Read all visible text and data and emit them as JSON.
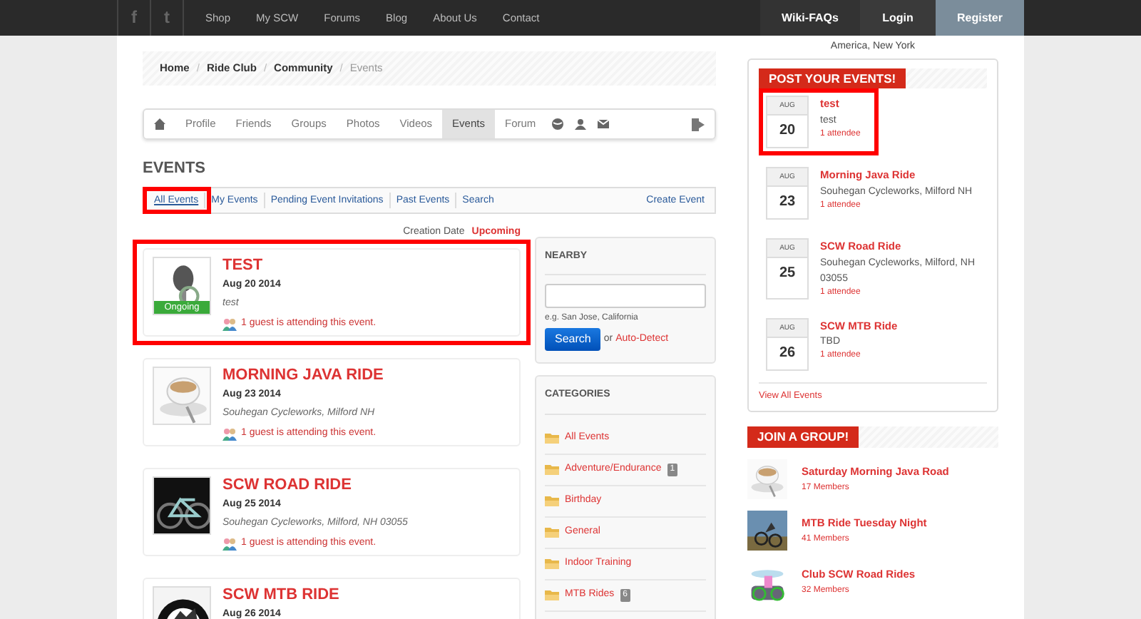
{
  "top_nav": {
    "social": [
      {
        "icon": "f"
      },
      {
        "icon": "t"
      }
    ],
    "links": [
      "Shop",
      "My SCW",
      "Forums",
      "Blog",
      "About Us",
      "Contact"
    ],
    "account": [
      {
        "label": "Wiki-FAQs",
        "kind": "wiki"
      },
      {
        "label": "Login",
        "kind": "login"
      },
      {
        "label": "Register",
        "kind": "register"
      }
    ]
  },
  "breadcrumb": [
    {
      "label": "Home",
      "current": false
    },
    {
      "separator": "/",
      "label": "Ride Club",
      "current": false
    },
    {
      "separator": "/",
      "label": "Community",
      "current": false
    },
    {
      "separator": "/",
      "label": "Events",
      "current": true
    }
  ],
  "profile_nav": [
    {
      "label": "Profile",
      "selected": false
    },
    {
      "label": "Friends",
      "selected": false
    },
    {
      "label": "Groups",
      "selected": false
    },
    {
      "label": "Photos",
      "selected": false
    },
    {
      "label": "Videos",
      "selected": false
    },
    {
      "label": "Events",
      "selected": true
    },
    {
      "label": "Forum",
      "selected": false
    }
  ],
  "heading": "EVENTS",
  "event_tabs": [
    {
      "label": "All Events",
      "selected": true,
      "highlighted": true
    },
    {
      "label": "My Events",
      "selected": false,
      "highlighted": false
    },
    {
      "label": "Pending Event Invitations",
      "selected": false,
      "highlighted": false
    },
    {
      "label": "Past Events",
      "selected": false,
      "highlighted": false
    },
    {
      "label": "Search",
      "selected": false,
      "highlighted": false
    }
  ],
  "create_event": "Create Event",
  "sort": [
    {
      "label": "Creation Date",
      "selected": false
    },
    {
      "label": "Upcoming",
      "selected": true
    }
  ],
  "events": [
    {
      "title": "TEST",
      "date": "Aug 20 2014",
      "location": "test",
      "attendance": "1 guest is attending this event.",
      "status": "Ongoing",
      "highlighted": true
    },
    {
      "title": "MORNING JAVA RIDE",
      "date": "Aug 23 2014",
      "location": "Souhegan Cycleworks, Milford NH",
      "attendance": "1 guest is attending this event.",
      "highlighted": false
    },
    {
      "title": "SCW ROAD RIDE",
      "date": "Aug 25 2014",
      "location": "Souhegan Cycleworks, Milford, NH 03055",
      "attendance": "1 guest is attending this event.",
      "highlighted": false
    },
    {
      "title": "SCW MTB RIDE",
      "date": "Aug 26 2014",
      "highlighted": false
    }
  ],
  "nearby": {
    "title": "NEARBY",
    "hint": "e.g. San Jose, California",
    "button": "Search",
    "or": "or",
    "auto_detect": "Auto-Detect"
  },
  "categories": {
    "title": "CATEGORIES",
    "items": [
      {
        "label": "All Events"
      },
      {
        "label": "Adventure/Endurance",
        "count": "1"
      },
      {
        "label": "Birthday"
      },
      {
        "label": "General"
      },
      {
        "label": "Indoor Training"
      },
      {
        "label": "MTB Rides",
        "count": "6"
      }
    ]
  },
  "timezone": "America, New York",
  "post_events": {
    "title": "POST YOUR EVENTS!",
    "items": [
      {
        "month": "AUG",
        "day": "20",
        "title": "test",
        "location": "test",
        "attendees": "1 attendee",
        "highlighted": true
      },
      {
        "month": "AUG",
        "day": "23",
        "title": "Morning Java Ride",
        "location": "Souhegan Cycleworks, Milford NH",
        "attendees": "1 attendee",
        "highlighted": false
      },
      {
        "month": "AUG",
        "day": "25",
        "title": "SCW Road Ride",
        "location": "Souhegan Cycleworks, Milford, NH 03055",
        "attendees": "1 attendee",
        "highlighted": false
      },
      {
        "month": "AUG",
        "day": "26",
        "title": "SCW MTB Ride",
        "location": "TBD",
        "attendees": "1 attendee",
        "highlighted": false
      }
    ],
    "view_all": "View All Events"
  },
  "join_group": {
    "title": "JOIN A GROUP!",
    "groups": [
      {
        "name": "Saturday Morning Java Road",
        "members": "17 Members"
      },
      {
        "name": "MTB Ride Tuesday Night",
        "members": "41 Members"
      },
      {
        "name": "Club SCW Road Rides",
        "members": "32 Members"
      }
    ]
  }
}
